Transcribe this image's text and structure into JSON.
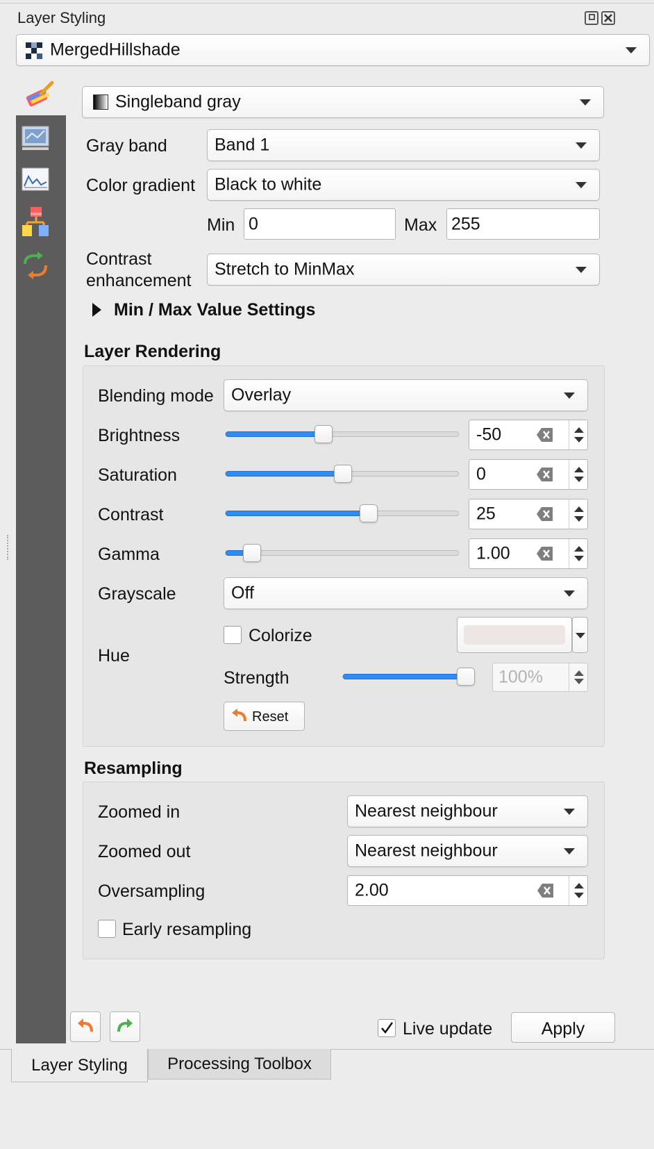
{
  "panel": {
    "title": "Layer Styling"
  },
  "layer_select": {
    "value": "MergedHillshade"
  },
  "renderer": {
    "value": "Singleband gray"
  },
  "band_rendering": {
    "gray_band_label": "Gray band",
    "gray_band_value": "Band 1",
    "color_gradient_label": "Color gradient",
    "color_gradient_value": "Black to white",
    "min_label": "Min",
    "min_value": "0",
    "max_label": "Max",
    "max_value": "255",
    "contrast_label_line1": "Contrast",
    "contrast_label_line2": "enhancement",
    "contrast_value": "Stretch to MinMax",
    "minmax_settings": "Min / Max Value Settings"
  },
  "layer_rendering": {
    "heading": "Layer Rendering",
    "blending_label": "Blending mode",
    "blending_value": "Overlay",
    "brightness_label": "Brightness",
    "brightness_value": "-50",
    "brightness_level": 0.41,
    "saturation_label": "Saturation",
    "saturation_value": "0",
    "saturation_level": 0.5,
    "contrast_label": "Contrast",
    "contrast_value": "25",
    "contrast_level": 0.62,
    "gamma_label": "Gamma",
    "gamma_value": "1.00",
    "gamma_level": 0.08,
    "grayscale_label": "Grayscale",
    "grayscale_value": "Off",
    "hue_label": "Hue",
    "colorize_label": "Colorize",
    "strength_label": "Strength",
    "strength_value": "100%",
    "strength_level": 1.0,
    "reset_label": "Reset"
  },
  "resampling": {
    "heading": "Resampling",
    "zoomed_in_label": "Zoomed in",
    "zoomed_in_value": "Nearest neighbour",
    "zoomed_out_label": "Zoomed out",
    "zoomed_out_value": "Nearest neighbour",
    "oversampling_label": "Oversampling",
    "oversampling_value": "2.00",
    "early_label": "Early resampling"
  },
  "footer": {
    "live_update_label": "Live update",
    "apply_label": "Apply"
  },
  "tabs": {
    "tab1": "Layer Styling",
    "tab2": "Processing Toolbox"
  },
  "colors": {
    "accent": "#2f8cf1",
    "sidebar": "#5c5c5c",
    "panel_bg": "#ececec"
  }
}
